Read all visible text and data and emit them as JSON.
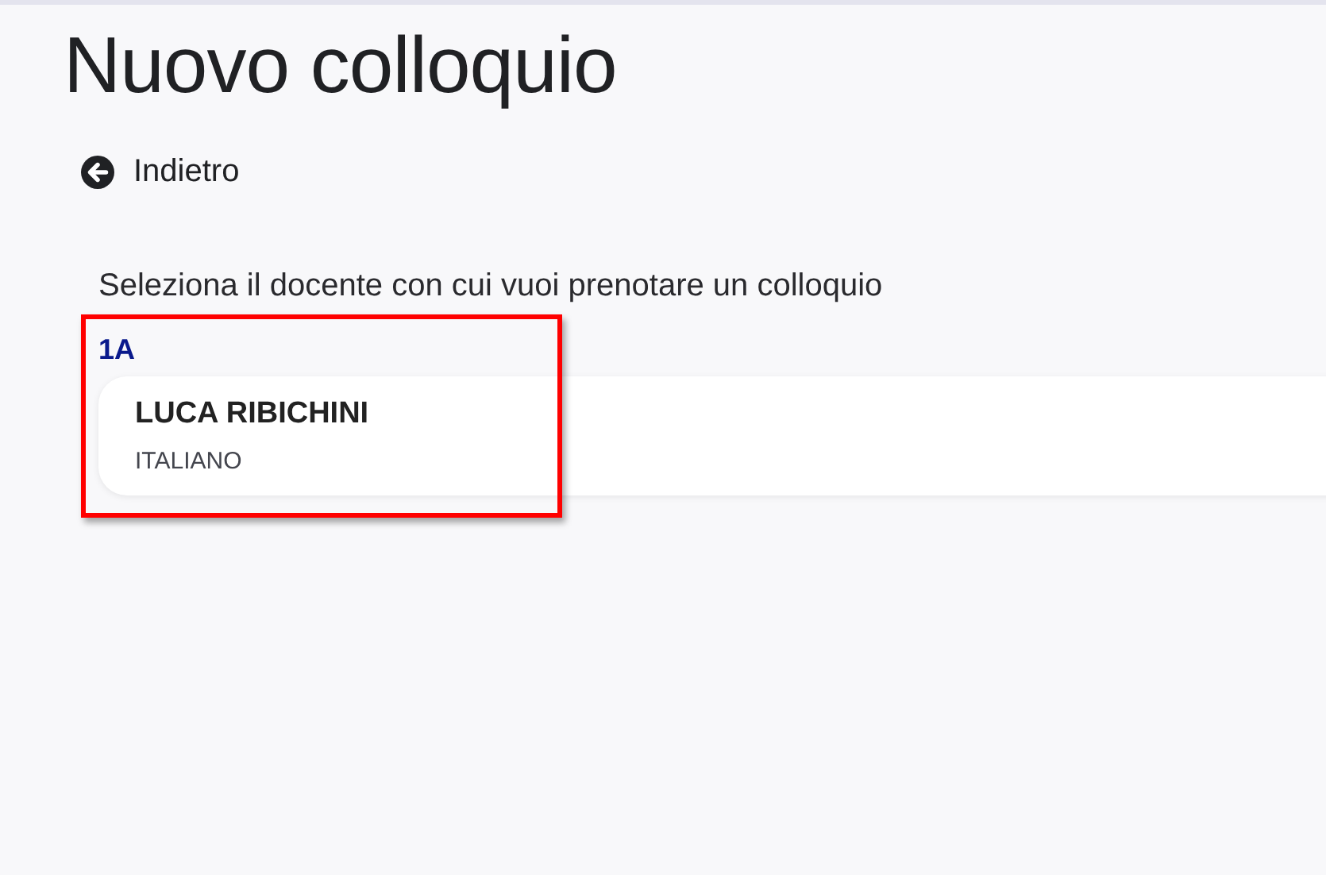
{
  "title": "Nuovo colloquio",
  "back_link": {
    "label": "Indietro"
  },
  "instruction": "Seleziona il docente con cui vuoi prenotare un colloquio",
  "groups": [
    {
      "label": "1A",
      "highlighted": true,
      "teachers": [
        {
          "name": "LUCA RIBICHINI",
          "subject": "ITALIANO"
        }
      ]
    }
  ]
}
